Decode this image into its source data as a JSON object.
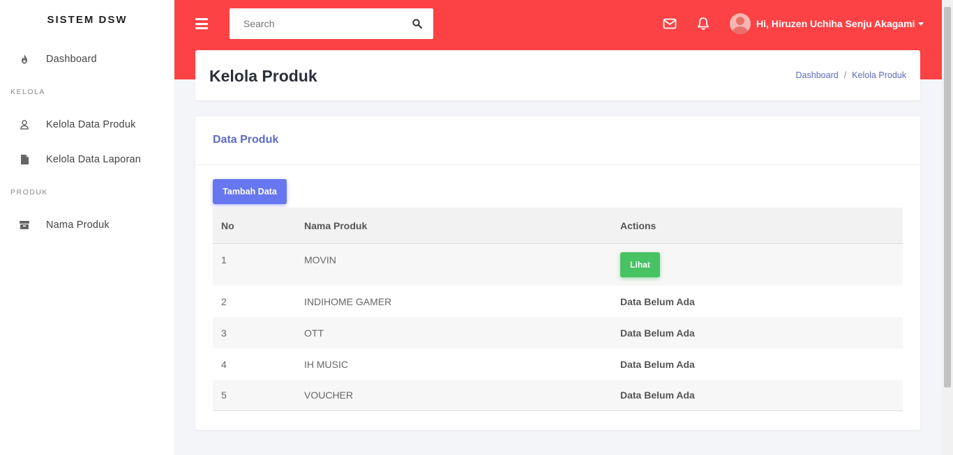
{
  "brand": "SISTEM DSW",
  "sidebar": {
    "dashboard": {
      "label": "Dashboard",
      "icon": "fire-icon"
    },
    "section_kelola": "KELOLA",
    "kelola_produk": {
      "label": "Kelola Data Produk",
      "icon": "user-icon"
    },
    "kelola_laporan": {
      "label": "Kelola Data Laporan",
      "icon": "file-icon"
    },
    "section_produk": "PRODUK",
    "nama_produk": {
      "label": "Nama Produk",
      "icon": "box-icon"
    }
  },
  "topbar": {
    "search_placeholder": "Search",
    "user_greeting": "Hi, Hiruzen Uchiha Senju Akagami",
    "accent_color": "#fc4245"
  },
  "page": {
    "title": "Kelola Produk",
    "breadcrumb": [
      "Dashboard",
      "Kelola Produk"
    ]
  },
  "card": {
    "title": "Data Produk",
    "add_button": "Tambah Data",
    "columns": [
      "No",
      "Nama Produk",
      "Actions"
    ],
    "rows": [
      {
        "no": "1",
        "name": "MOVIN",
        "action": "Lihat"
      },
      {
        "no": "2",
        "name": "INDIHOME GAMER",
        "action": "Data Belum Ada"
      },
      {
        "no": "3",
        "name": "OTT",
        "action": "Data Belum Ada"
      },
      {
        "no": "4",
        "name": "IH MUSIC",
        "action": "Data Belum Ada"
      },
      {
        "no": "5",
        "name": "VOUCHER",
        "action": "Data Belum Ada"
      }
    ]
  }
}
